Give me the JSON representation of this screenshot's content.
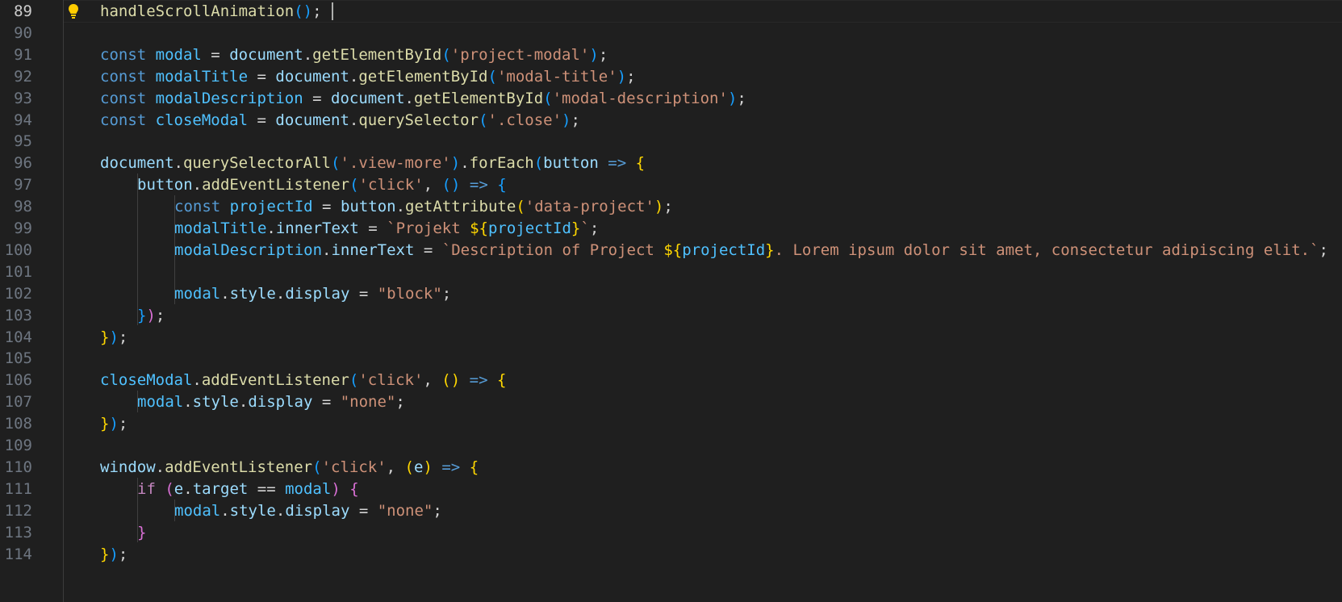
{
  "editor": {
    "active_line": 89,
    "colors": {
      "background": "#1f1f1f",
      "keyword": "#569cd6",
      "control": "#c586c0",
      "variable": "#9cdcfe",
      "constant": "#4fc1ff",
      "function": "#dcdcaa",
      "string": "#ce9178",
      "bracket_1": "#ffd700",
      "bracket_2": "#da70d6",
      "bracket_3": "#179fff"
    },
    "lines": [
      {
        "num": 89,
        "indent": 1,
        "tokens": [
          [
            "fn",
            "handleScrollAnimation"
          ],
          [
            "p3",
            "()"
          ],
          [
            "op",
            ";"
          ]
        ]
      },
      {
        "num": 90,
        "indent": 0,
        "tokens": []
      },
      {
        "num": 91,
        "indent": 1,
        "tokens": [
          [
            "kw",
            "const"
          ],
          [
            "op",
            " "
          ],
          [
            "cst",
            "modal"
          ],
          [
            "op",
            " = "
          ],
          [
            "var",
            "document"
          ],
          [
            "op",
            "."
          ],
          [
            "fn",
            "getElementById"
          ],
          [
            "p3",
            "("
          ],
          [
            "str",
            "'project-modal'"
          ],
          [
            "p3",
            ")"
          ],
          [
            "op",
            ";"
          ]
        ]
      },
      {
        "num": 92,
        "indent": 1,
        "tokens": [
          [
            "kw",
            "const"
          ],
          [
            "op",
            " "
          ],
          [
            "cst",
            "modalTitle"
          ],
          [
            "op",
            " = "
          ],
          [
            "var",
            "document"
          ],
          [
            "op",
            "."
          ],
          [
            "fn",
            "getElementById"
          ],
          [
            "p3",
            "("
          ],
          [
            "str",
            "'modal-title'"
          ],
          [
            "p3",
            ")"
          ],
          [
            "op",
            ";"
          ]
        ]
      },
      {
        "num": 93,
        "indent": 1,
        "tokens": [
          [
            "kw",
            "const"
          ],
          [
            "op",
            " "
          ],
          [
            "cst",
            "modalDescription"
          ],
          [
            "op",
            " = "
          ],
          [
            "var",
            "document"
          ],
          [
            "op",
            "."
          ],
          [
            "fn",
            "getElementById"
          ],
          [
            "p3",
            "("
          ],
          [
            "str",
            "'modal-description'"
          ],
          [
            "p3",
            ")"
          ],
          [
            "op",
            ";"
          ]
        ]
      },
      {
        "num": 94,
        "indent": 1,
        "tokens": [
          [
            "kw",
            "const"
          ],
          [
            "op",
            " "
          ],
          [
            "cst",
            "closeModal"
          ],
          [
            "op",
            " = "
          ],
          [
            "var",
            "document"
          ],
          [
            "op",
            "."
          ],
          [
            "fn",
            "querySelector"
          ],
          [
            "p3",
            "("
          ],
          [
            "str",
            "'.close'"
          ],
          [
            "p3",
            ")"
          ],
          [
            "op",
            ";"
          ]
        ]
      },
      {
        "num": 95,
        "indent": 0,
        "tokens": []
      },
      {
        "num": 96,
        "indent": 1,
        "tokens": [
          [
            "var",
            "document"
          ],
          [
            "op",
            "."
          ],
          [
            "fn",
            "querySelectorAll"
          ],
          [
            "p3",
            "("
          ],
          [
            "str",
            "'.view-more'"
          ],
          [
            "p3",
            ")"
          ],
          [
            "op",
            "."
          ],
          [
            "fn",
            "forEach"
          ],
          [
            "p3",
            "("
          ],
          [
            "var",
            "button"
          ],
          [
            "op",
            " "
          ],
          [
            "kw",
            "=>"
          ],
          [
            "op",
            " "
          ],
          [
            "p1",
            "{"
          ]
        ]
      },
      {
        "num": 97,
        "indent": 2,
        "tokens": [
          [
            "var",
            "button"
          ],
          [
            "op",
            "."
          ],
          [
            "fn",
            "addEventListener"
          ],
          [
            "p3",
            "("
          ],
          [
            "str",
            "'click'"
          ],
          [
            "op",
            ", "
          ],
          [
            "p3",
            "()"
          ],
          [
            "op",
            " "
          ],
          [
            "kw",
            "=>"
          ],
          [
            "op",
            " "
          ],
          [
            "p3",
            "{"
          ]
        ]
      },
      {
        "num": 98,
        "indent": 3,
        "tokens": [
          [
            "kw",
            "const"
          ],
          [
            "op",
            " "
          ],
          [
            "cst",
            "projectId"
          ],
          [
            "op",
            " = "
          ],
          [
            "var",
            "button"
          ],
          [
            "op",
            "."
          ],
          [
            "fn",
            "getAttribute"
          ],
          [
            "p1",
            "("
          ],
          [
            "str",
            "'data-project'"
          ],
          [
            "p1",
            ")"
          ],
          [
            "op",
            ";"
          ]
        ]
      },
      {
        "num": 99,
        "indent": 3,
        "tokens": [
          [
            "cst",
            "modalTitle"
          ],
          [
            "op",
            "."
          ],
          [
            "var",
            "innerText"
          ],
          [
            "op",
            " = "
          ],
          [
            "str",
            "`Projekt "
          ],
          [
            "p1",
            "${"
          ],
          [
            "cst",
            "projectId"
          ],
          [
            "p1",
            "}"
          ],
          [
            "str",
            "`"
          ],
          [
            "op",
            ";"
          ]
        ]
      },
      {
        "num": 100,
        "indent": 3,
        "tokens": [
          [
            "cst",
            "modalDescription"
          ],
          [
            "op",
            "."
          ],
          [
            "var",
            "innerText"
          ],
          [
            "op",
            " = "
          ],
          [
            "str",
            "`Description of Project "
          ],
          [
            "p1",
            "${"
          ],
          [
            "cst",
            "projectId"
          ],
          [
            "p1",
            "}"
          ],
          [
            "str",
            ". Lorem ipsum dolor sit amet, consectetur adipiscing elit.`"
          ],
          [
            "op",
            ";"
          ]
        ]
      },
      {
        "num": 101,
        "indent": 0,
        "tokens": []
      },
      {
        "num": 102,
        "indent": 3,
        "tokens": [
          [
            "cst",
            "modal"
          ],
          [
            "op",
            "."
          ],
          [
            "var",
            "style"
          ],
          [
            "op",
            "."
          ],
          [
            "var",
            "display"
          ],
          [
            "op",
            " = "
          ],
          [
            "str",
            "\"block\""
          ],
          [
            "op",
            ";"
          ]
        ]
      },
      {
        "num": 103,
        "indent": 2,
        "tokens": [
          [
            "p3",
            "}"
          ],
          [
            "p2",
            ")"
          ],
          [
            "op",
            ";"
          ]
        ]
      },
      {
        "num": 104,
        "indent": 1,
        "tokens": [
          [
            "p1",
            "}"
          ],
          [
            "p3",
            ")"
          ],
          [
            "op",
            ";"
          ]
        ]
      },
      {
        "num": 105,
        "indent": 0,
        "tokens": []
      },
      {
        "num": 106,
        "indent": 1,
        "tokens": [
          [
            "cst",
            "closeModal"
          ],
          [
            "op",
            "."
          ],
          [
            "fn",
            "addEventListener"
          ],
          [
            "p3",
            "("
          ],
          [
            "str",
            "'click'"
          ],
          [
            "op",
            ", "
          ],
          [
            "p1",
            "()"
          ],
          [
            "op",
            " "
          ],
          [
            "kw",
            "=>"
          ],
          [
            "op",
            " "
          ],
          [
            "p1",
            "{"
          ]
        ]
      },
      {
        "num": 107,
        "indent": 2,
        "tokens": [
          [
            "cst",
            "modal"
          ],
          [
            "op",
            "."
          ],
          [
            "var",
            "style"
          ],
          [
            "op",
            "."
          ],
          [
            "var",
            "display"
          ],
          [
            "op",
            " = "
          ],
          [
            "str",
            "\"none\""
          ],
          [
            "op",
            ";"
          ]
        ]
      },
      {
        "num": 108,
        "indent": 1,
        "tokens": [
          [
            "p1",
            "}"
          ],
          [
            "p3",
            ")"
          ],
          [
            "op",
            ";"
          ]
        ]
      },
      {
        "num": 109,
        "indent": 0,
        "tokens": []
      },
      {
        "num": 110,
        "indent": 1,
        "tokens": [
          [
            "var",
            "window"
          ],
          [
            "op",
            "."
          ],
          [
            "fn",
            "addEventListener"
          ],
          [
            "p3",
            "("
          ],
          [
            "str",
            "'click'"
          ],
          [
            "op",
            ", "
          ],
          [
            "p1",
            "("
          ],
          [
            "var",
            "e"
          ],
          [
            "p1",
            ")"
          ],
          [
            "op",
            " "
          ],
          [
            "kw",
            "=>"
          ],
          [
            "op",
            " "
          ],
          [
            "p1",
            "{"
          ]
        ]
      },
      {
        "num": 111,
        "indent": 2,
        "tokens": [
          [
            "ctl",
            "if"
          ],
          [
            "op",
            " "
          ],
          [
            "p2",
            "("
          ],
          [
            "var",
            "e"
          ],
          [
            "op",
            "."
          ],
          [
            "var",
            "target"
          ],
          [
            "op",
            " == "
          ],
          [
            "cst",
            "modal"
          ],
          [
            "p2",
            ")"
          ],
          [
            "op",
            " "
          ],
          [
            "p2",
            "{"
          ]
        ]
      },
      {
        "num": 112,
        "indent": 3,
        "tokens": [
          [
            "cst",
            "modal"
          ],
          [
            "op",
            "."
          ],
          [
            "var",
            "style"
          ],
          [
            "op",
            "."
          ],
          [
            "var",
            "display"
          ],
          [
            "op",
            " = "
          ],
          [
            "str",
            "\"none\""
          ],
          [
            "op",
            ";"
          ]
        ]
      },
      {
        "num": 113,
        "indent": 2,
        "tokens": [
          [
            "p2",
            "}"
          ]
        ]
      },
      {
        "num": 114,
        "indent": 1,
        "tokens": [
          [
            "p1",
            "}"
          ],
          [
            "p3",
            ")"
          ],
          [
            "op",
            ";"
          ]
        ]
      }
    ]
  }
}
